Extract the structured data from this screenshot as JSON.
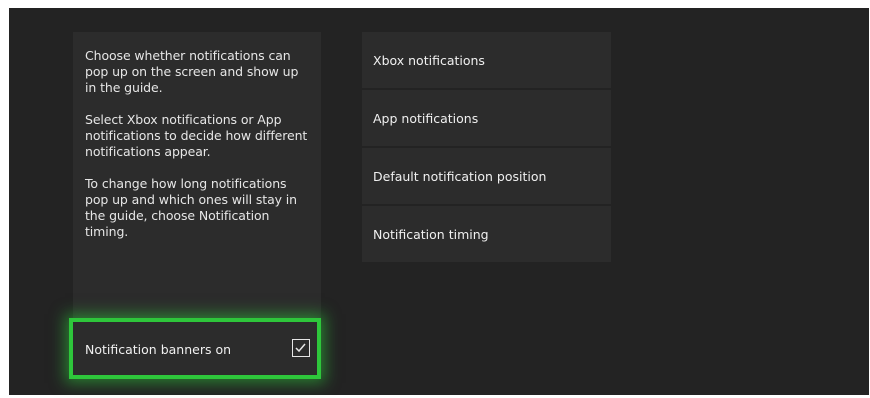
{
  "info": {
    "paragraphs": [
      "Choose whether notifications can pop up on the screen and show up in the guide.",
      "Select Xbox notifications or App notifications to decide how different notifications appear.",
      "To change how long notifications pop up and which ones will stay in the guide, choose Notification timing."
    ]
  },
  "toggle": {
    "label": "Notification banners on",
    "checked": true,
    "focus_color": "#2ec63b"
  },
  "menu": {
    "items": [
      {
        "label": "Xbox notifications"
      },
      {
        "label": "App notifications"
      },
      {
        "label": "Default notification position"
      },
      {
        "label": "Notification timing"
      }
    ]
  },
  "colors": {
    "background": "#232323",
    "tile": "#2c2c2c",
    "text": "#f0f0f0",
    "focus": "#2ec63b"
  }
}
